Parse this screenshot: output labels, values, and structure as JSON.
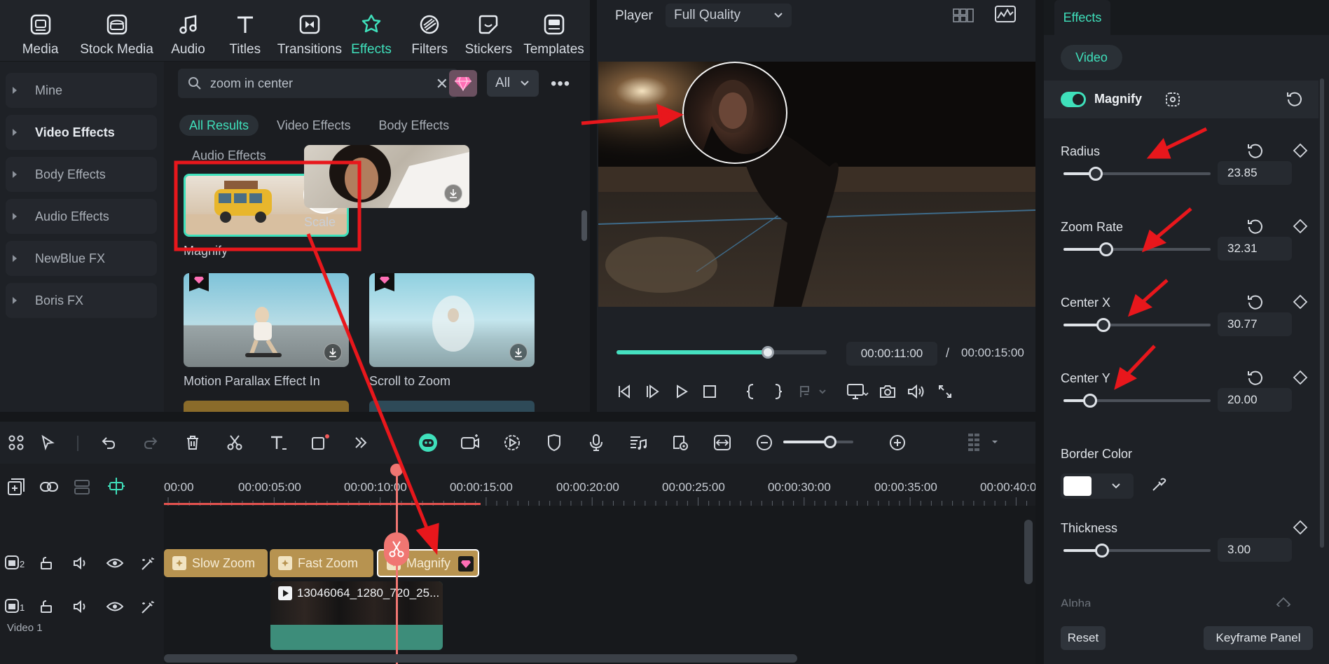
{
  "top_tabs": [
    {
      "label": "Media",
      "icon": "media-icon"
    },
    {
      "label": "Stock Media",
      "icon": "stock-media-icon"
    },
    {
      "label": "Audio",
      "icon": "music-note-icon"
    },
    {
      "label": "Titles",
      "icon": "titles-t-icon"
    },
    {
      "label": "Transitions",
      "icon": "transitions-icon"
    },
    {
      "label": "Effects",
      "icon": "effects-icon",
      "active": true
    },
    {
      "label": "Filters",
      "icon": "filters-icon"
    },
    {
      "label": "Stickers",
      "icon": "stickers-icon"
    },
    {
      "label": "Templates",
      "icon": "templates-icon"
    }
  ],
  "categories": [
    "Mine",
    "Video Effects",
    "Body Effects",
    "Audio Effects",
    "NewBlue FX",
    "Boris FX"
  ],
  "selected_category": "Video Effects",
  "search": {
    "value": "zoom in center",
    "filter": "All"
  },
  "sub_tabs": [
    "All Results",
    "Video Effects",
    "Body Effects"
  ],
  "sub_tab_overflow": "Audio Effects",
  "results": [
    {
      "name": "Magnify"
    },
    {
      "name": "Scale"
    },
    {
      "name": "Motion Parallax Effect In"
    },
    {
      "name": "Scroll to Zoom"
    }
  ],
  "player": {
    "label": "Player",
    "quality": "Full Quality",
    "current_time": "00:00:11:00",
    "separator": "/",
    "total_time": "00:00:15:00",
    "progress": 0.72
  },
  "timeline": {
    "ruler": [
      "00:00",
      "00:00:05:00",
      "00:00:10:00",
      "00:00:15:00",
      "00:00:20:00",
      "00:00:25:00",
      "00:00:30:00",
      "00:00:35:00",
      "00:00:40:00"
    ],
    "track2_number": "2",
    "track1_number": "1",
    "track1_name": "Video 1",
    "effect_clips": [
      "Slow Zoom",
      "Fast Zoom",
      "Magnify"
    ],
    "video_clip": "13046064_1280_720_25..."
  },
  "properties": {
    "tab": "Effects",
    "pill": "Video",
    "effect_name": "Magnify",
    "params": [
      {
        "label": "Radius",
        "value": "23.85",
        "level": 0.22
      },
      {
        "label": "Zoom Rate",
        "value": "32.31",
        "level": 0.29
      },
      {
        "label": "Center X",
        "value": "30.77",
        "level": 0.27
      },
      {
        "label": "Center Y",
        "value": "20.00",
        "level": 0.18
      }
    ],
    "border_color_label": "Border Color",
    "border_color": "#ffffff",
    "thickness": {
      "label": "Thickness",
      "value": "3.00",
      "level": 0.26
    },
    "alpha_label": "Alpha",
    "reset_label": "Reset",
    "keyframe_panel_label": "Keyframe Panel"
  },
  "colors": {
    "accent": "#3fe0bb",
    "clip": "#b79350",
    "playhead": "#f07672",
    "annotation": "#e8171c"
  }
}
